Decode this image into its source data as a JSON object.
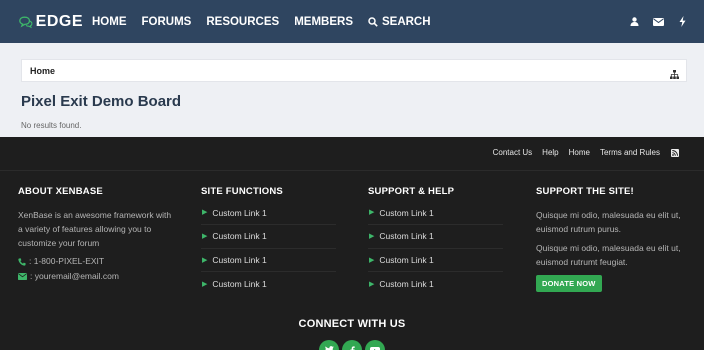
{
  "header": {
    "logo_text": "EDGE",
    "nav": [
      {
        "label": "HOME"
      },
      {
        "label": "FORUMS"
      },
      {
        "label": "RESOURCES"
      },
      {
        "label": "MEMBERS"
      },
      {
        "label": "SEARCH",
        "icon": "search-icon"
      }
    ],
    "right_icons": [
      "user-icon",
      "envelope-icon",
      "bolt-icon"
    ],
    "background": "#2f4560"
  },
  "breadcrumb": {
    "home": "Home"
  },
  "main": {
    "title": "Pixel Exit Demo Board",
    "empty_text": "No results found."
  },
  "footer_links": [
    "Contact Us",
    "Help",
    "Home",
    "Terms and Rules"
  ],
  "columns": {
    "about": {
      "title": "ABOUT XENBASE",
      "text": "XenBase is an awesome framework with a variety of features allowing you to customize your forum",
      "phone": ": 1-800-PIXEL-EXIT",
      "email": ": youremail@email.com"
    },
    "site_functions": {
      "title": "SITE FUNCTIONS",
      "links": [
        "Custom Link 1",
        "Custom Link 1",
        "Custom Link 1",
        "Custom Link 1"
      ]
    },
    "support": {
      "title": "SUPPORT & HELP",
      "links": [
        "Custom Link 1",
        "Custom Link 1",
        "Custom Link 1",
        "Custom Link 1"
      ]
    },
    "support_site": {
      "title": "SUPPORT THE SITE!",
      "p1": "Quisque mi odio, malesuada eu elit ut, euismod rutrum purus.",
      "p2": "Quisque mi odio, malesuada eu elit ut, euismod rutrumt feugiat.",
      "donate_label": "DONATE NOW"
    }
  },
  "connect": {
    "title": "CONNECT WITH US",
    "social": [
      "twitter-icon",
      "facebook-icon",
      "youtube-icon"
    ]
  },
  "colors": {
    "accent": "#32a852",
    "footer_bg": "#1e1e1e",
    "main_bg": "#eef0f4"
  }
}
